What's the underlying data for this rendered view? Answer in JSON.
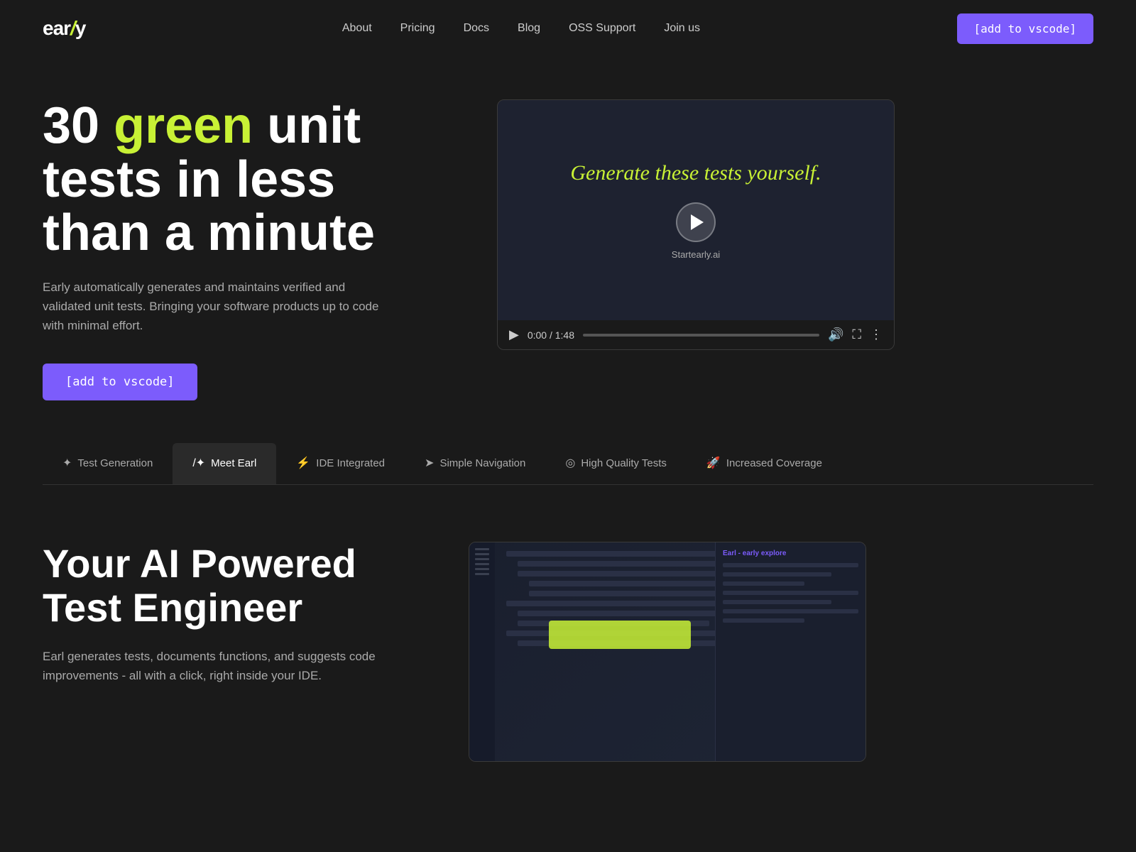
{
  "brand": {
    "name_prefix": "ear",
    "name_slash": "/",
    "name_suffix": "y"
  },
  "navbar": {
    "links": [
      {
        "label": "About",
        "href": "#"
      },
      {
        "label": "Pricing",
        "href": "#"
      },
      {
        "label": "Docs",
        "href": "#"
      },
      {
        "label": "Blog",
        "href": "#"
      },
      {
        "label": "OSS Support",
        "href": "#"
      },
      {
        "label": "Join us",
        "href": "#"
      }
    ],
    "cta_label": "[add to vscode]"
  },
  "hero": {
    "title_part1": "30 ",
    "title_green": "green",
    "title_part2": " unit tests in less than a minute",
    "description": "Early automatically generates and maintains verified and validated unit tests. Bringing your software products up to code with minimal effort.",
    "cta_label": "[add to vscode]"
  },
  "video": {
    "screen_text": "Generate these tests yourself.",
    "url_text": "Startearly.ai",
    "time_current": "0:00",
    "time_total": "1:48",
    "time_display": "0:00 / 1:48"
  },
  "tabs": [
    {
      "id": "test-generation",
      "label": "Test Generation",
      "icon": "✦",
      "active": false
    },
    {
      "id": "meet-earl",
      "label": "Meet Earl",
      "icon": "/✦",
      "active": true
    },
    {
      "id": "ide-integrated",
      "label": "IDE Integrated",
      "icon": "⚡",
      "active": false
    },
    {
      "id": "simple-navigation",
      "label": "Simple Navigation",
      "icon": "➤",
      "active": false
    },
    {
      "id": "high-quality-tests",
      "label": "High Quality Tests",
      "icon": "◎",
      "active": false
    },
    {
      "id": "increased-coverage",
      "label": "Increased Coverage",
      "icon": "🚀",
      "active": false
    }
  ],
  "second_section": {
    "title": "Your AI Powered Test Engineer",
    "description": "Earl generates tests, documents functions, and suggests code improvements - all with a click, right inside your IDE."
  }
}
